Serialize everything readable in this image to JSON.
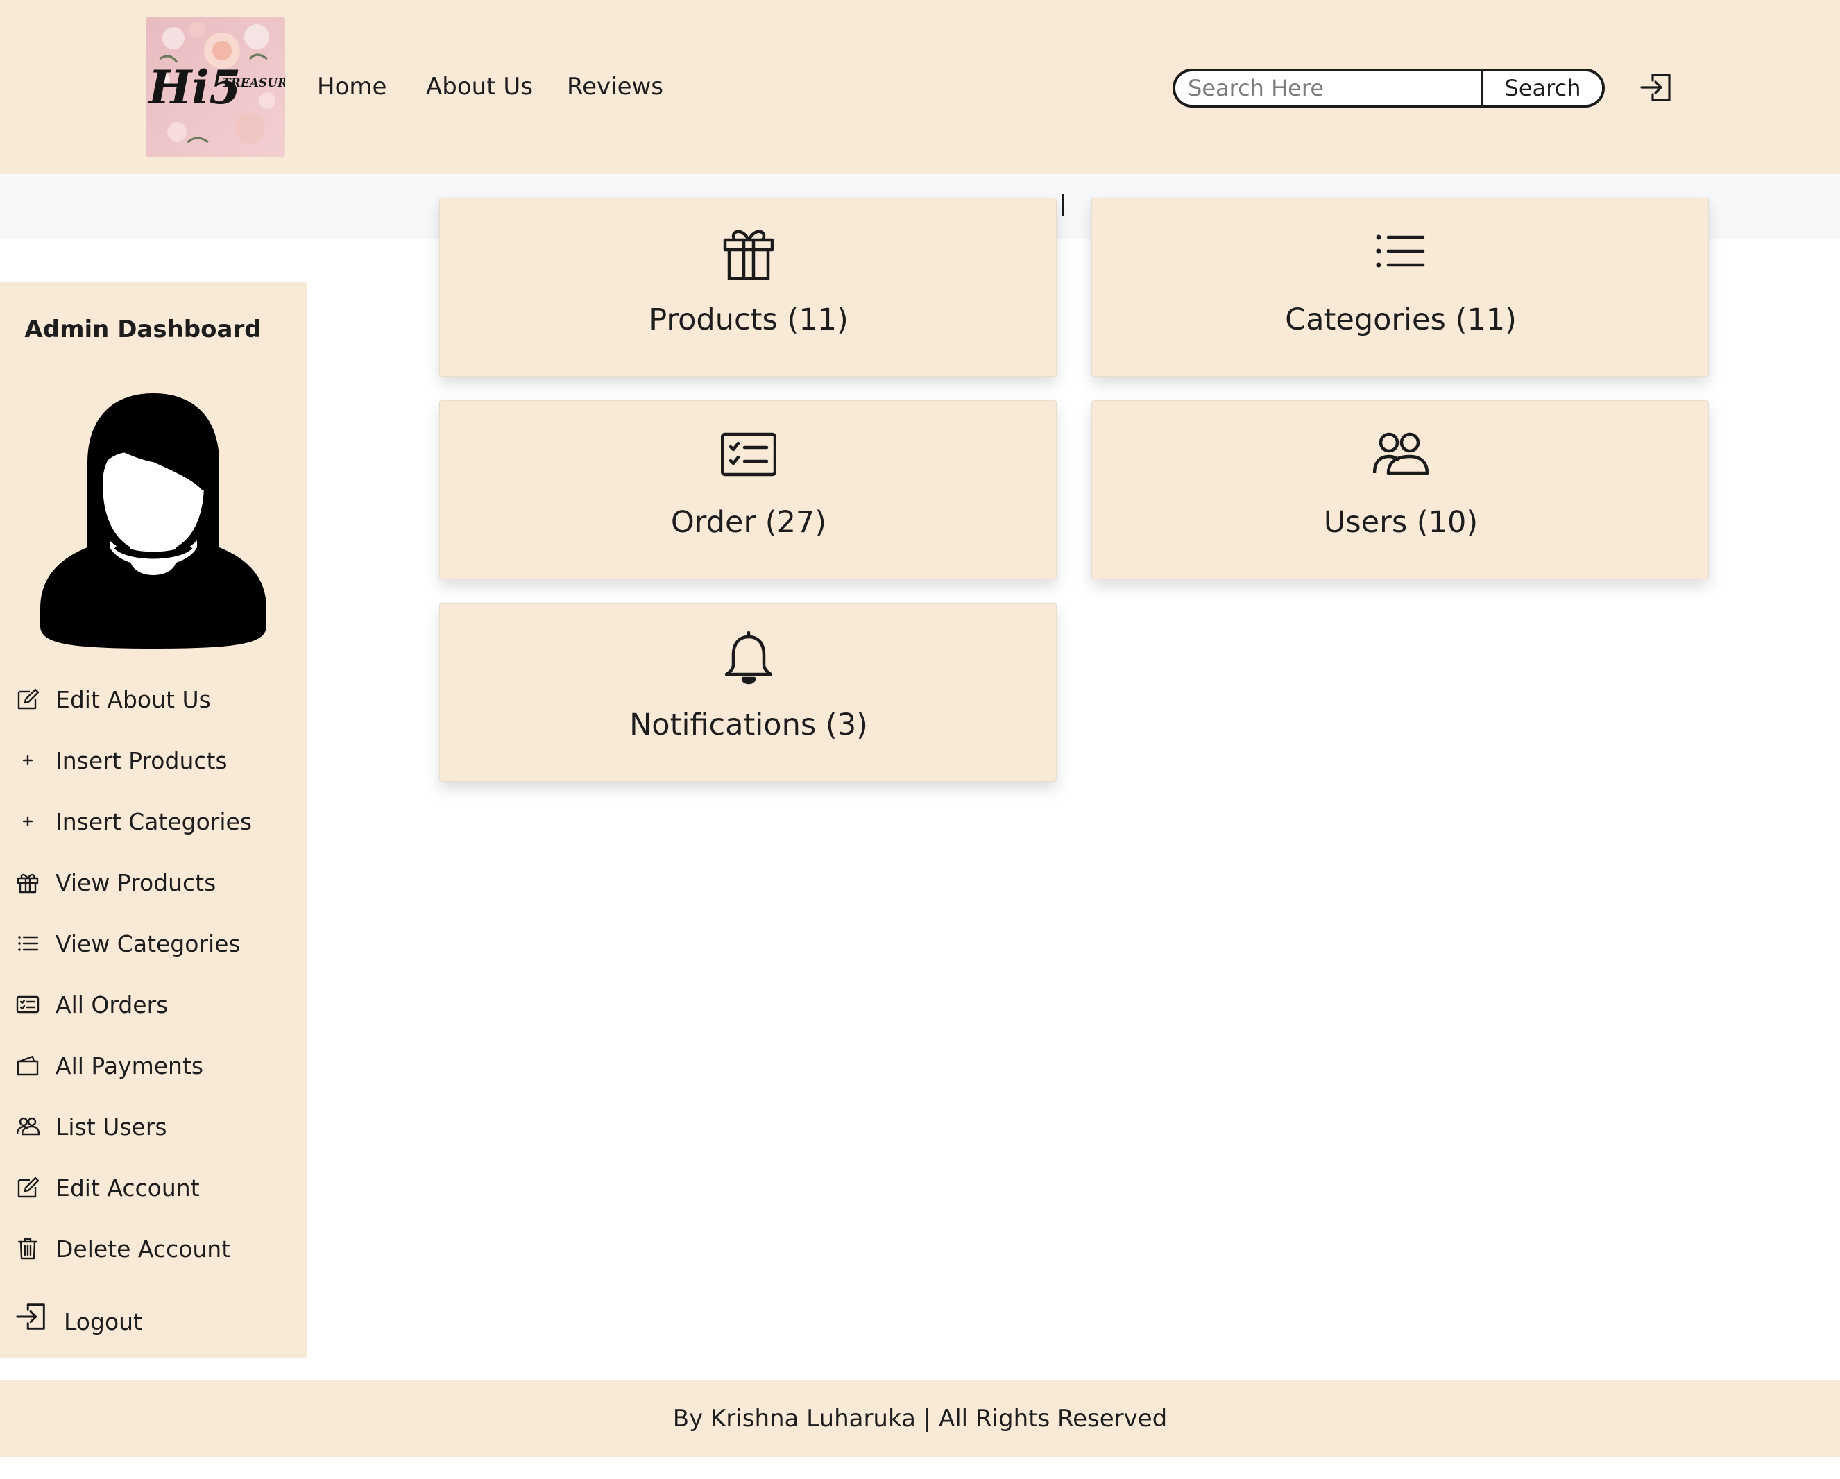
{
  "header": {
    "logo_text": "Hi5",
    "logo_subtext": "TREASURES",
    "nav": [
      {
        "label": "Home"
      },
      {
        "label": "About Us"
      },
      {
        "label": "Reviews"
      }
    ],
    "search": {
      "placeholder": "Search Here",
      "value": "",
      "button_label": "Search"
    },
    "login_icon": "login-icon"
  },
  "sidebar": {
    "title": "Admin Dashboard",
    "avatar_icon": "user-avatar-icon",
    "items": [
      {
        "label": "Edit About Us",
        "icon": "edit-icon"
      },
      {
        "label": "Insert Products",
        "icon": "plus-icon"
      },
      {
        "label": "Insert Categories",
        "icon": "plus-icon"
      },
      {
        "label": "View Products",
        "icon": "gift-icon"
      },
      {
        "label": "View Categories",
        "icon": "list-icon"
      },
      {
        "label": "All Orders",
        "icon": "card-checklist-icon"
      },
      {
        "label": "All Payments",
        "icon": "wallet-icon"
      },
      {
        "label": "List Users",
        "icon": "people-icon"
      },
      {
        "label": "Edit Account",
        "icon": "edit-icon"
      },
      {
        "label": "Delete Account",
        "icon": "trash-icon"
      }
    ],
    "logout": {
      "label": "Logout",
      "icon": "login-icon"
    }
  },
  "cards": [
    {
      "label": "Products (11)",
      "icon": "gift-icon"
    },
    {
      "label": "Categories (11)",
      "icon": "list-icon"
    },
    {
      "label": "Order (27)",
      "icon": "card-checklist-icon"
    },
    {
      "label": "Users (10)",
      "icon": "people-icon"
    },
    {
      "label": "Notifications (3)",
      "icon": "bell-icon"
    }
  ],
  "footer": {
    "text": "By Krishna Luharuka | All Rights Reserved"
  },
  "colors": {
    "panel": "#f9ead8",
    "strip": "#f7f8fa",
    "text": "#1d1d1d",
    "background": "#ffffff"
  }
}
